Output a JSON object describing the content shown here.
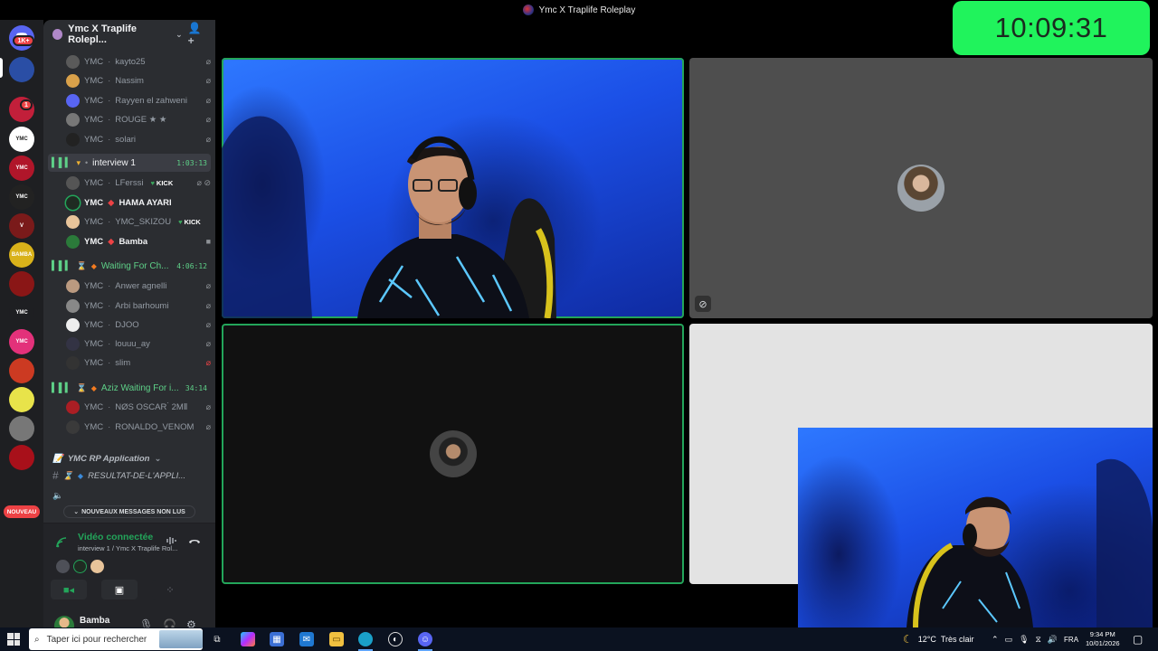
{
  "window": {
    "title": "Ymc X Traplife Roleplay"
  },
  "clock": {
    "time": "10:09:31"
  },
  "rail": {
    "mention_badge": "1K+",
    "unread_badge": "1",
    "new_label": "NOUVEAU",
    "server_tiles": [
      {
        "label": "",
        "color": "#2a4ea5"
      },
      {
        "label": "",
        "color": "#c21f3a"
      },
      {
        "label": "YMC",
        "color": "#ffffff"
      },
      {
        "label": "YMC",
        "color": "#b0162a"
      },
      {
        "label": "YMC",
        "color": "#222222"
      },
      {
        "label": "V",
        "color": "#7a1a1a"
      },
      {
        "label": "BAMBA",
        "color": "#d9b21a"
      },
      {
        "label": "",
        "color": "#8a1616"
      },
      {
        "label": "YMC",
        "color": "#1e1f22"
      },
      {
        "label": "YMC",
        "color": "#e3317a"
      },
      {
        "label": "",
        "color": "#cc3a22"
      },
      {
        "label": "",
        "color": "#e8e34a"
      },
      {
        "label": "",
        "color": "#777777"
      },
      {
        "label": "",
        "color": "#a8101a"
      }
    ]
  },
  "sidebar": {
    "guild_name": "Ymc X Traplife Rolepl...",
    "colors": {
      "speaking": "#23a55a",
      "voice_channel": "#5ed188",
      "kick_heart": "#3ba55d",
      "alert": "#ed4245"
    },
    "lobby_users": [
      {
        "tag": "YMC",
        "name": "kayto25",
        "bold": false
      },
      {
        "tag": "YMC",
        "name": "Nassim",
        "bold": false
      },
      {
        "tag": "YMC",
        "name": "Rayyen el zahweni",
        "bold": false
      },
      {
        "tag": "YMC",
        "name": "ROUGE ★ ★",
        "bold": false
      },
      {
        "tag": "YMC",
        "name": "solari",
        "bold": false
      }
    ],
    "channels": [
      {
        "name": "interview 1",
        "timer": "1:03:13",
        "active": true,
        "users": [
          {
            "tag": "YMC",
            "name": "LFerssi",
            "bold": false,
            "kick": "KICK"
          },
          {
            "tag": "YMC",
            "name": "HAMA AYARI",
            "bold": true,
            "kick": ""
          },
          {
            "tag": "YMC",
            "name": "YMC_SKIZOU",
            "bold": false,
            "kick": "KICK"
          },
          {
            "tag": "YMC",
            "name": "Bamba",
            "bold": true,
            "kick": ""
          }
        ]
      },
      {
        "name": "Waiting For Ch...",
        "timer": "4:06:12",
        "active": false,
        "users": [
          {
            "tag": "YMC",
            "name": "Anwer agnelli"
          },
          {
            "tag": "YMC",
            "name": "Arbi barhoumi"
          },
          {
            "tag": "YMC",
            "name": "DJOO"
          },
          {
            "tag": "YMC",
            "name": "louuu_ay"
          },
          {
            "tag": "YMC",
            "name": "slim"
          }
        ]
      },
      {
        "name": "Aziz Waiting For i...",
        "timer": "34:14",
        "active": false,
        "users": [
          {
            "tag": "YMC",
            "name": "NØS OSCAR ̀ 2MⅡ"
          },
          {
            "tag": "YMC",
            "name": "RONALDO_VENOM"
          }
        ]
      }
    ],
    "category": "YMC RP Application",
    "text_channel": "RESULTAT-DE-L'APPLI...",
    "unread_pill": "NOUVEAUX MESSAGES NON LUS"
  },
  "voice_panel": {
    "status": "Vidéo connectée",
    "location": "interview 1 / Ymc X Traplife Rol..."
  },
  "user_panel": {
    "name": "Bamba",
    "status": "invisible"
  },
  "taskbar": {
    "search_placeholder": "Taper ici pour rechercher",
    "weather_temp": "12°C",
    "weather_desc": "Très clair",
    "language": "FRA",
    "time": "9:34 PM",
    "date": "10/01/2026"
  }
}
